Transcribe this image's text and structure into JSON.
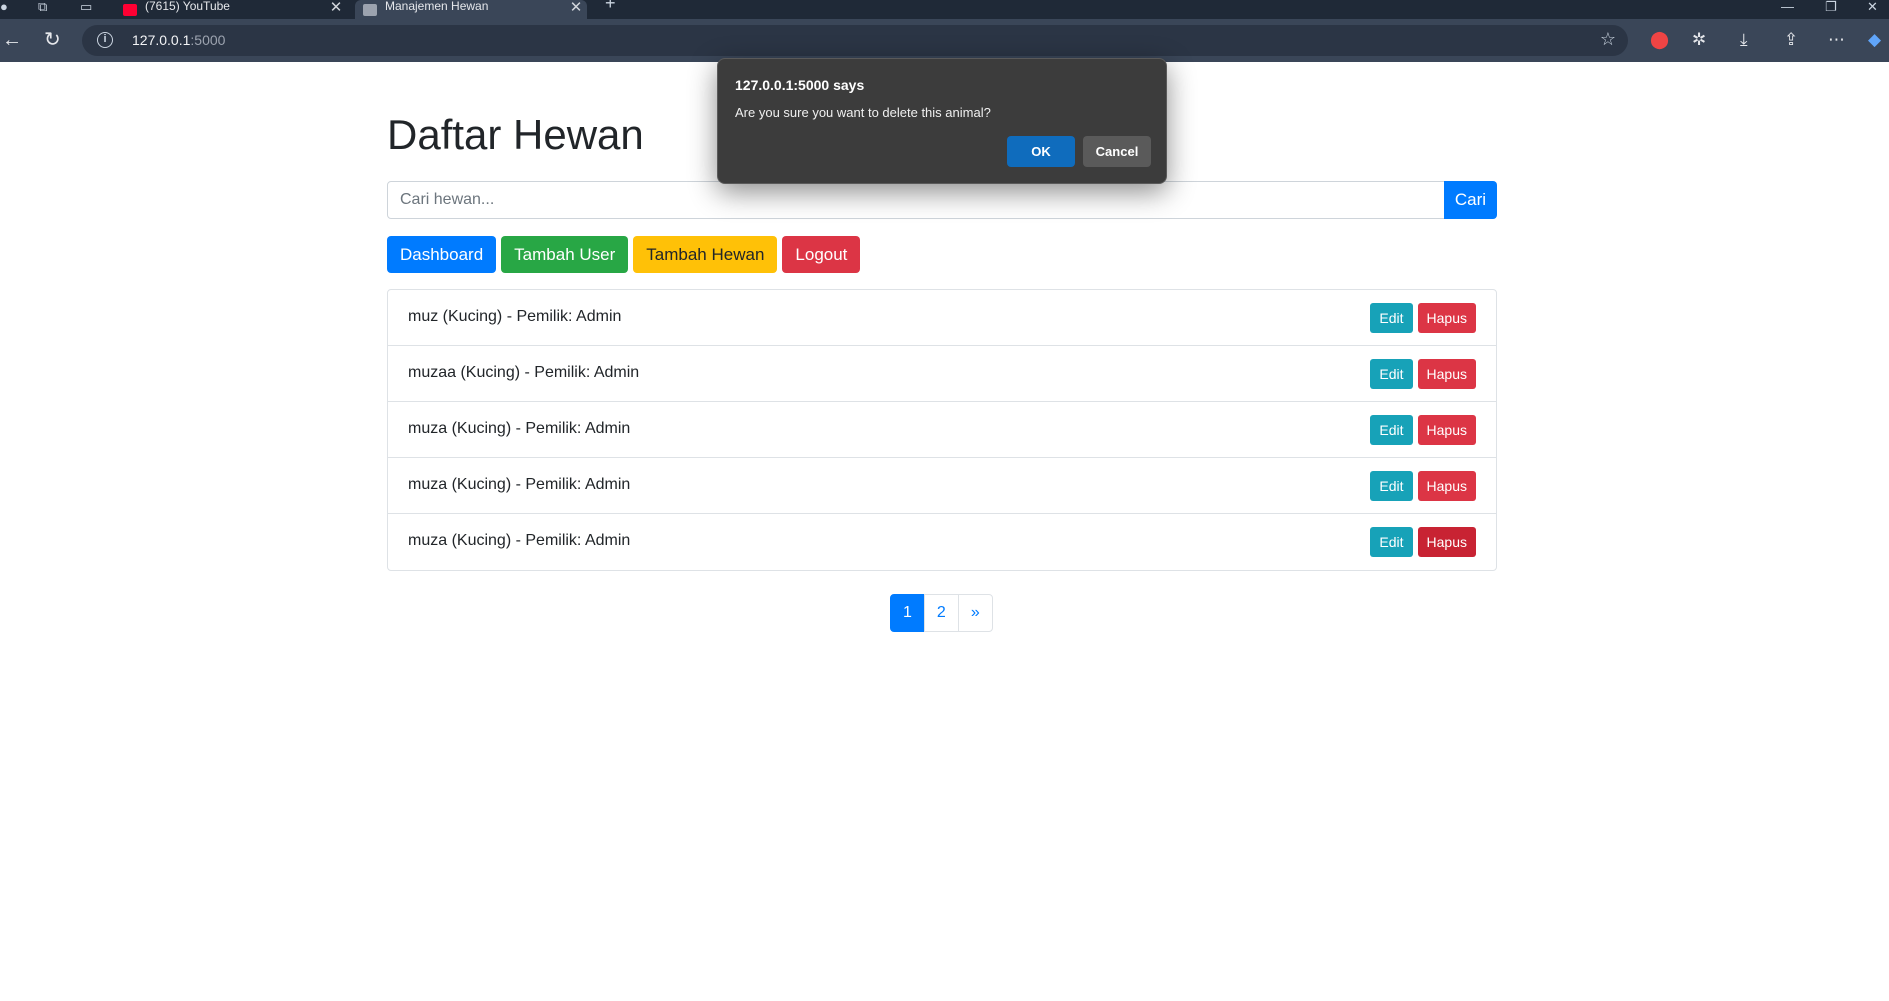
{
  "browser": {
    "tabs": [
      {
        "title": "(7615) YouTube",
        "favicon_color": "#ff0033"
      },
      {
        "title": "Manajemen Hewan",
        "favicon_color": "#9ca3af"
      }
    ],
    "close_glyph": "✕",
    "new_tab_glyph": "+",
    "url_host": "127.0.0.1",
    "url_port": ":5000",
    "icons": {
      "back": "back-arrow-icon",
      "refresh": "refresh-icon",
      "info": "site-info-icon",
      "favorite": "star-icon",
      "extension_red": "adblock-icon",
      "extensions": "puzzle-icon",
      "downloads": "download-icon",
      "share": "share-icon",
      "more": "more-icon",
      "copilot": "copilot-icon"
    }
  },
  "page": {
    "title": "Daftar Hewan",
    "search": {
      "placeholder": "Cari hewan...",
      "button": "Cari"
    },
    "buttons": {
      "dashboard": "Dashboard",
      "tambah_user": "Tambah User",
      "tambah_hewan": "Tambah Hewan",
      "logout": "Logout"
    },
    "animals": [
      {
        "text": "muz (Kucing) - Pemilik: Admin",
        "edit": "Edit",
        "delete": "Hapus"
      },
      {
        "text": "muzaa (Kucing) - Pemilik: Admin",
        "edit": "Edit",
        "delete": "Hapus"
      },
      {
        "text": "muza (Kucing) - Pemilik: Admin",
        "edit": "Edit",
        "delete": "Hapus"
      },
      {
        "text": "muza (Kucing) - Pemilik: Admin",
        "edit": "Edit",
        "delete": "Hapus"
      },
      {
        "text": "muza (Kucing) - Pemilik: Admin",
        "edit": "Edit",
        "delete": "Hapus"
      }
    ],
    "pagination": {
      "pages": [
        "1",
        "2"
      ],
      "current": "1",
      "next": "»"
    }
  },
  "dialog": {
    "title": "127.0.0.1:5000 says",
    "message": "Are you sure you want to delete this animal?",
    "ok": "OK",
    "cancel": "Cancel"
  },
  "colors": {
    "primary": "#007bff",
    "success": "#28a745",
    "warning": "#ffc107",
    "danger": "#dc3545",
    "info": "#17a2b8",
    "dialog_bg": "#3c3c3c",
    "dialog_ok": "#0f6cbd"
  }
}
